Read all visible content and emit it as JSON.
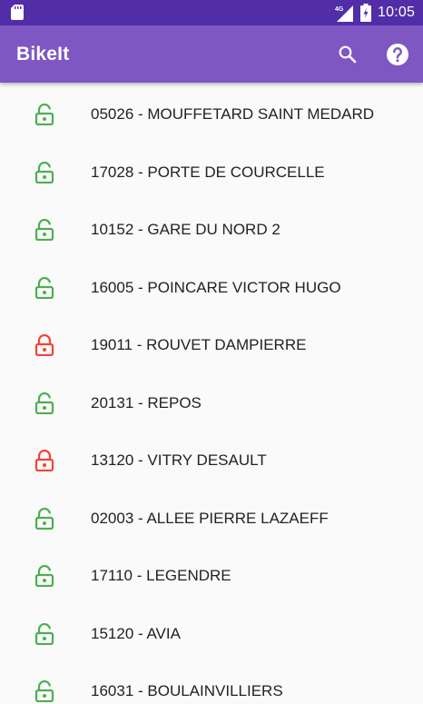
{
  "status_bar": {
    "time": "10:05",
    "network": "4G",
    "icons": [
      "sd-card-icon",
      "signal-icon",
      "battery-charging-icon"
    ]
  },
  "app_bar": {
    "title": "BikeIt",
    "actions": [
      "search-icon",
      "help-icon"
    ]
  },
  "colors": {
    "status_bar": "#512da8",
    "app_bar": "#7e57c2",
    "unlocked": "#4caf50",
    "locked": "#f44336"
  },
  "stations": [
    {
      "label": "05026 - MOUFFETARD SAINT MEDARD",
      "status": "open"
    },
    {
      "label": "17028 - PORTE DE COURCELLE",
      "status": "open"
    },
    {
      "label": "10152 - GARE DU NORD 2",
      "status": "open"
    },
    {
      "label": "16005 - POINCARE VICTOR HUGO",
      "status": "open"
    },
    {
      "label": "19011 - ROUVET DAMPIERRE",
      "status": "closed"
    },
    {
      "label": "20131 - REPOS",
      "status": "open"
    },
    {
      "label": "13120 - VITRY DESAULT",
      "status": "closed"
    },
    {
      "label": "02003 - ALLEE PIERRE LAZAEFF",
      "status": "open"
    },
    {
      "label": "17110 - LEGENDRE",
      "status": "open"
    },
    {
      "label": "15120 - AVIA",
      "status": "open"
    },
    {
      "label": "16031 - BOULAINVILLIERS",
      "status": "open"
    }
  ]
}
